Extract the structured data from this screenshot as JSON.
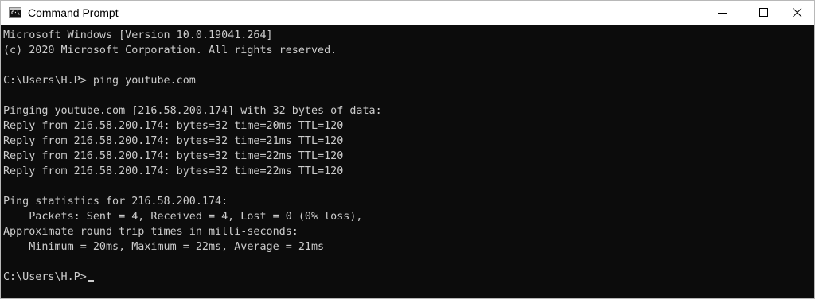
{
  "window": {
    "title": "Command Prompt",
    "icon": "cmd-icon",
    "icon_text": "C:\\.",
    "controls": [
      "minimize-icon",
      "maximize-icon",
      "close-icon"
    ]
  },
  "console": {
    "background": "#0c0c0c",
    "foreground": "#cccccc",
    "lines": [
      "Microsoft Windows [Version 10.0.19041.264]",
      "(c) 2020 Microsoft Corporation. All rights reserved.",
      "C:\\Users\\H.P> ping youtube.com",
      "Pinging youtube.com [216.58.200.174] with 32 bytes of data:",
      "Reply from 216.58.200.174: bytes=32 time=20ms TTL=120",
      "Reply from 216.58.200.174: bytes=32 time=21ms TTL=120",
      "Reply from 216.58.200.174: bytes=32 time=22ms TTL=120",
      "Reply from 216.58.200.174: bytes=32 time=22ms TTL=120",
      "Ping statistics for 216.58.200.174:",
      "    Packets: Sent = 4, Received = 4, Lost = 0 (0% loss),",
      "Approximate round trip times in milli-seconds:",
      "    Minimum = 20ms, Maximum = 22ms, Average = 21ms"
    ],
    "prompt": "C:\\Users\\H.P>"
  }
}
